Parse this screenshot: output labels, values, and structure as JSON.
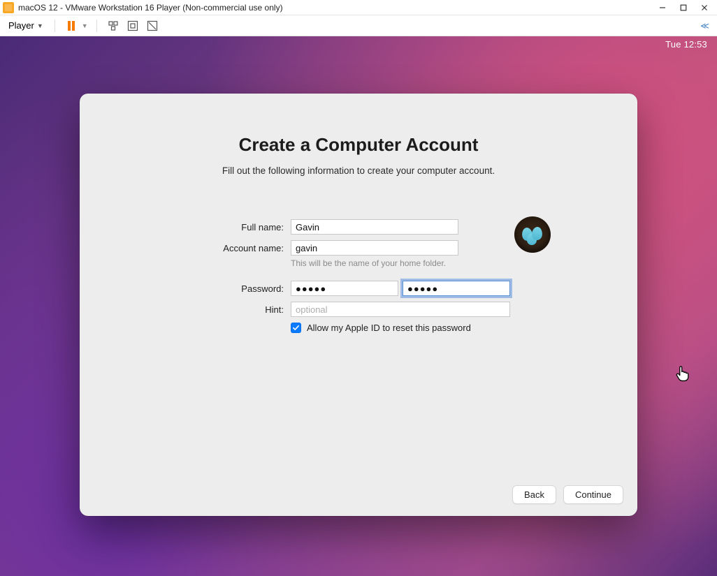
{
  "window": {
    "title": "macOS 12 - VMware Workstation 16 Player (Non-commercial use only)"
  },
  "toolbar": {
    "player_label": "Player",
    "collapse_glyph": "≪"
  },
  "menubar": {
    "clock": "Tue 12:53"
  },
  "dialog": {
    "title": "Create a Computer Account",
    "subtitle": "Fill out the following information to create your computer account.",
    "labels": {
      "full_name": "Full name:",
      "account_name": "Account name:",
      "password": "Password:",
      "hint": "Hint:"
    },
    "values": {
      "full_name": "Gavin",
      "account_name": "gavin",
      "password": "●●●●●",
      "password_verify": "●●●●●",
      "hint": ""
    },
    "placeholders": {
      "hint": "optional"
    },
    "helper_account_name": "This will be the name of your home folder.",
    "checkbox_label": "Allow my Apple ID to reset this password",
    "checkbox_checked": true,
    "avatar_name": "blue-eggs-nest"
  },
  "footer": {
    "back": "Back",
    "continue": "Continue"
  }
}
